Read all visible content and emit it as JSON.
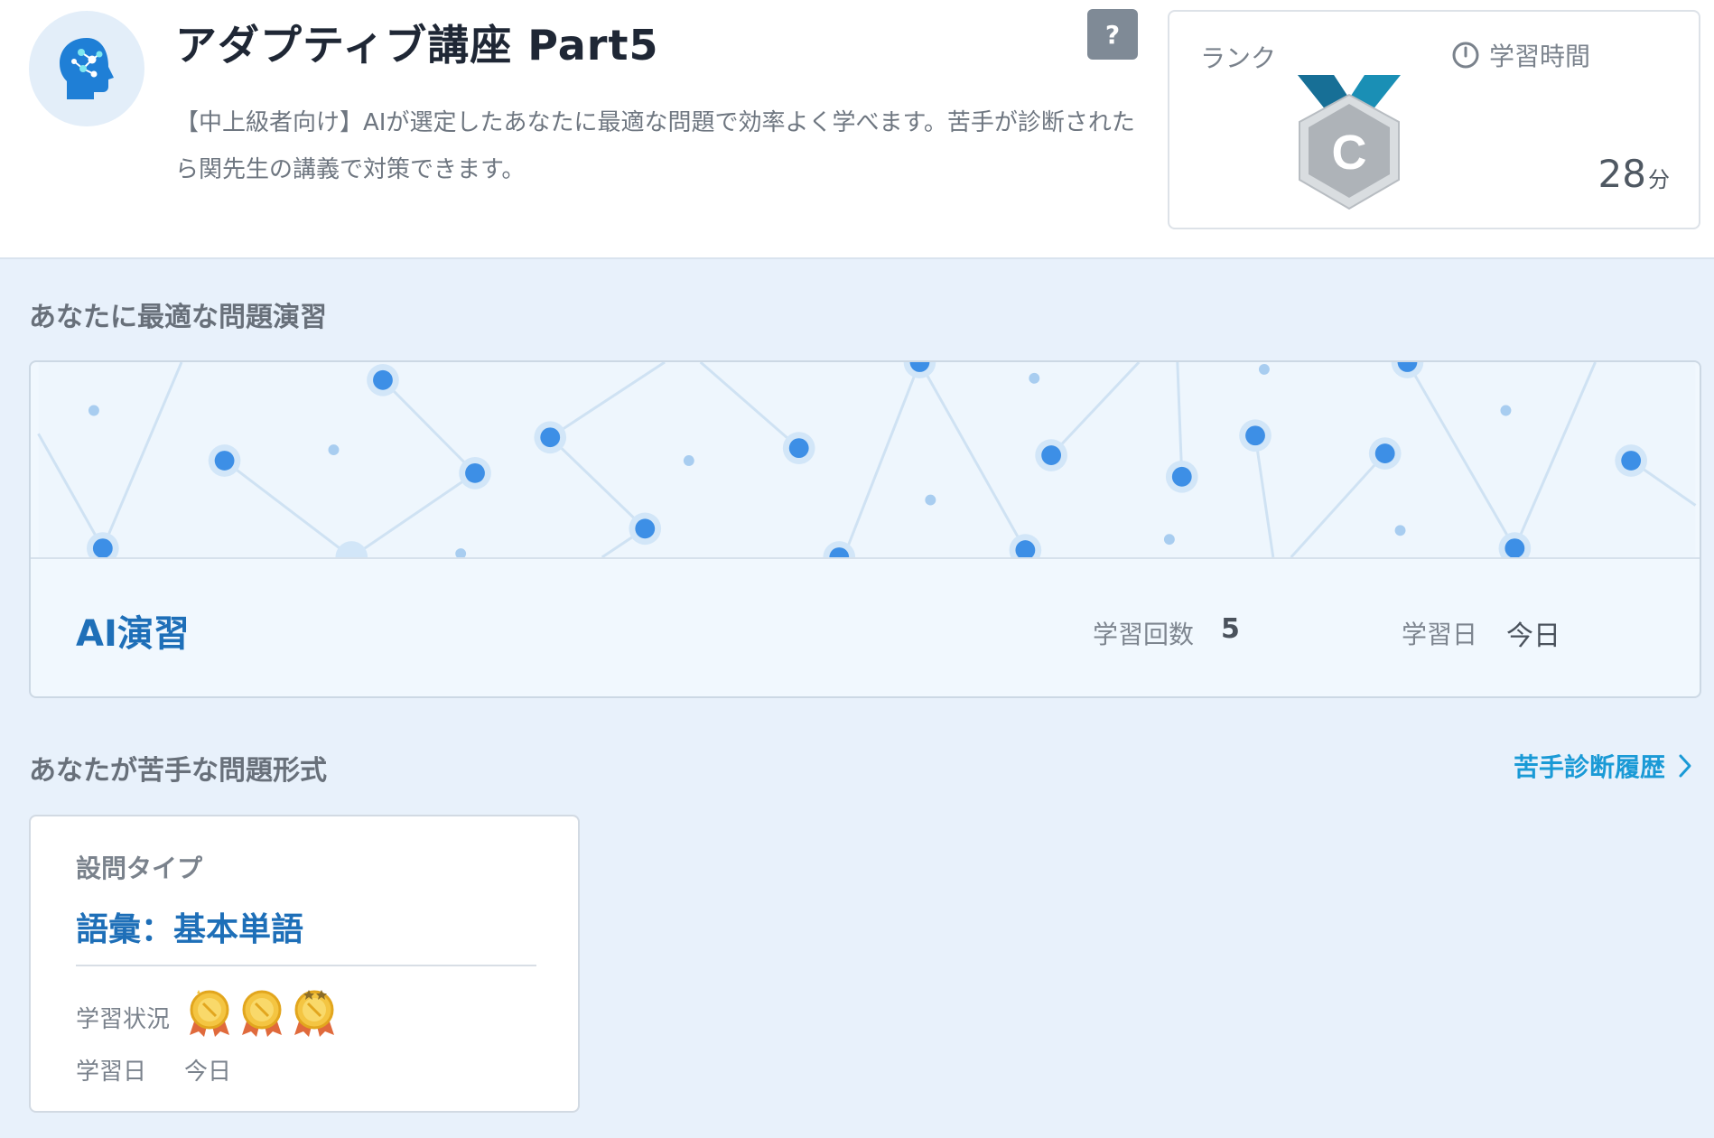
{
  "header": {
    "title": "アダプティブ講座 Part5",
    "description": "【中上級者向け】AIが選定したあなたに最適な問題で効率よく学べます。苦手が診断されたら関先生の講義で対策できます。",
    "help_label": "?",
    "icon": "brain-head-icon"
  },
  "stats": {
    "rank_label": "ランク",
    "rank_value": "C",
    "time_label": "学習時間",
    "time_value": "28",
    "time_unit": "分"
  },
  "optimal_section": {
    "title": "あなたに最適な問題演習",
    "card": {
      "title": "AI演習",
      "count_label": "学習回数",
      "count_value": "5",
      "date_label": "学習日",
      "date_value": "今日"
    }
  },
  "weak_section": {
    "title": "あなたが苦手な問題形式",
    "history_link": "苦手診断履歴",
    "cards": [
      {
        "type_label": "設問タイプ",
        "type_value": "語彙：基本単語",
        "status_label": "学習状況",
        "medals": [
          "gold-medal-icon",
          "gold-medal-icon",
          "gold-medal-icon"
        ],
        "date_label": "学習日",
        "date_value": "今日"
      }
    ]
  },
  "colors": {
    "accent": "#1e6fb8",
    "link": "#1a9ad6",
    "background": "#e8f1fb",
    "node": "#3d8fe6"
  }
}
